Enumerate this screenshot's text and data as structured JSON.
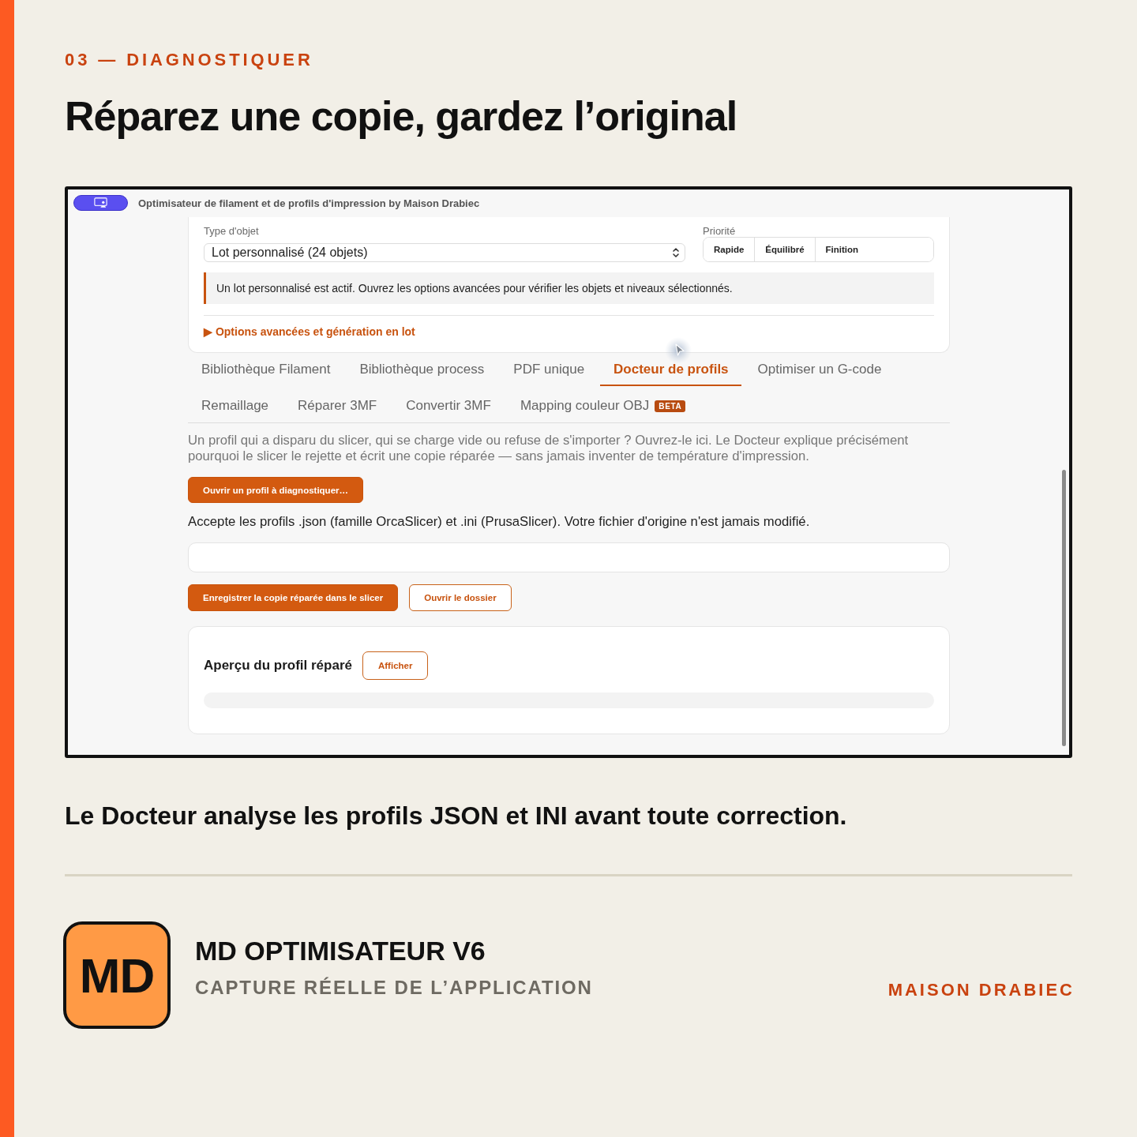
{
  "eyebrow": "03 — DIAGNOSTIQUER",
  "headline": "Réparez une copie, gardez l’original",
  "app_window": {
    "title": "Optimisateur de filament et de profils d'impression by Maison Drabiec",
    "object_type": {
      "label": "Type d'objet",
      "value": "Lot personnalisé (24 objets)"
    },
    "priority": {
      "label": "Priorité",
      "options": [
        {
          "label": "Rapide",
          "selected": false
        },
        {
          "label": "Équilibré",
          "selected": false
        },
        {
          "label": "Finition",
          "selected": false
        }
      ]
    },
    "notice": "Un lot personnalisé est actif. Ouvrez les options avancées pour vérifier les objets et niveaux sélectionnés.",
    "advanced_options": "▶ Options avancées et génération en lot",
    "tabs": [
      {
        "label": "Bibliothèque Filament",
        "selected": false
      },
      {
        "label": "Bibliothèque process",
        "selected": false
      },
      {
        "label": "PDF unique",
        "selected": false
      },
      {
        "label": "Docteur de profils",
        "selected": true
      },
      {
        "label": "Optimiser un G-code",
        "selected": false
      },
      {
        "label": "Remaillage",
        "selected": false
      },
      {
        "label": "Réparer 3MF",
        "selected": false
      },
      {
        "label": "Convertir 3MF",
        "selected": false
      },
      {
        "label": "Mapping couleur OBJ",
        "selected": false,
        "badge": "BETA"
      }
    ],
    "description": "Un profil qui a disparu du slicer, qui se charge vide ou refuse de s'importer ? Ouvrez-le ici. Le Docteur explique précisément pourquoi le slicer le rejette et écrit une copie réparée — sans jamais inventer de température d'impression.",
    "open_button": "Ouvrir un profil à diagnostiquer…",
    "accepted_formats": "Accepte les profils .json (famille OrcaSlicer) et .ini (PrusaSlicer). Votre fichier d'origine n'est jamais modifié.",
    "actions": [
      {
        "label": "Enregistrer la copie réparée dans le slicer",
        "kind": "primary"
      },
      {
        "label": "Ouvrir le dossier",
        "kind": "secondary"
      }
    ],
    "preview": {
      "title": "Aperçu du profil réparé",
      "button": "Afficher"
    }
  },
  "caption": "Le Docteur analyse les profils JSON et INI avant toute correction.",
  "footer": {
    "logo": "MD",
    "product": "MD OPTIMISATEUR V6",
    "subtitle": "CAPTURE RÉELLE DE L’APPLICATION",
    "brand": "MAISON DRABIEC"
  }
}
